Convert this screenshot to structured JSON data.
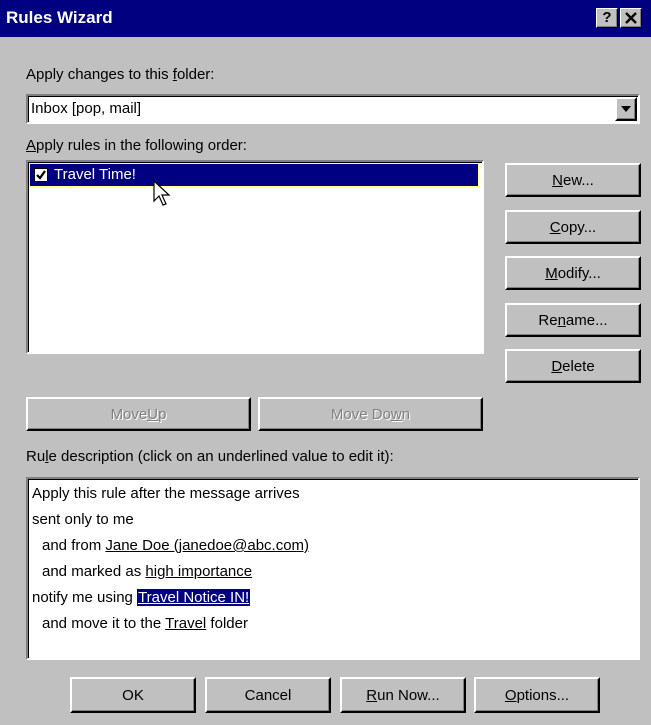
{
  "window": {
    "title": "Rules Wizard",
    "help_btn": "?",
    "close_btn": "×"
  },
  "folder": {
    "label_pre": "Apply changes to this ",
    "label_u": "f",
    "label_post": "older:",
    "value": "Inbox [pop, mail]"
  },
  "rules": {
    "label_u": "A",
    "label_post": "pply rules in the following order:",
    "items": [
      {
        "label": "Travel Time!",
        "checked": true,
        "selected": true
      }
    ]
  },
  "side_buttons": {
    "new": {
      "u": "N",
      "rest": "ew..."
    },
    "copy": {
      "u": "C",
      "rest": "opy..."
    },
    "modify": {
      "u": "M",
      "rest": "odify..."
    },
    "rename_pre": "Re",
    "rename_u": "n",
    "rename_post": "ame...",
    "delete": {
      "u": "D",
      "rest": "elete"
    }
  },
  "move": {
    "up_pre": "Move ",
    "up_u": "U",
    "up_post": "p",
    "down_pre": "Move Do",
    "down_u": "w",
    "down_post": "n"
  },
  "description": {
    "label_pre": "Ru",
    "label_u": "l",
    "label_post": "e description (click on an underlined value to edit it):",
    "line1": "Apply this rule after the message arrives",
    "line2": "sent only to me",
    "line3_pre": "and from ",
    "line3_link": "Jane Doe (janedoe@abc.com)",
    "line4_pre": "and marked as ",
    "line4_link": "high importance",
    "line5_pre": "notify me using ",
    "line5_link": "Travel Notice IN!",
    "line6_pre": "and move it to the ",
    "line6_link": "Travel",
    "line6_post": " folder"
  },
  "bottom_buttons": {
    "ok": "OK",
    "cancel": "Cancel",
    "run_u": "R",
    "run_rest": "un Now...",
    "options_u": "O",
    "options_rest": "ptions..."
  },
  "colors": {
    "titlebar": "#000080",
    "face": "#c0c0c0",
    "selection": "#000080"
  }
}
